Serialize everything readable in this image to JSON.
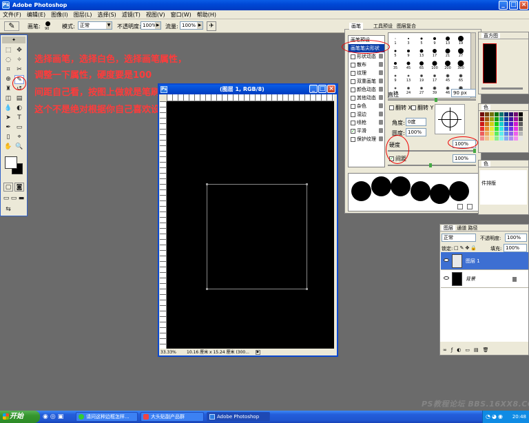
{
  "window": {
    "title": "Adobe Photoshop"
  },
  "menu": [
    "文件(F)",
    "编辑(E)",
    "图像(I)",
    "图层(L)",
    "选择(S)",
    "滤镜(T)",
    "视图(V)",
    "窗口(W)",
    "帮助(H)"
  ],
  "options": {
    "brush_label": "画笔:",
    "brush_size": "90",
    "mode_label": "模式:",
    "mode_value": "正常",
    "opacity_label": "不透明度:",
    "opacity_value": "100%",
    "flow_label": "流量:",
    "flow_value": "100%"
  },
  "annotation": {
    "line1": "选择画笔，选择白色，选择画笔属性，",
    "line2": "调整一下属性，硬度要是100",
    "line3": "间距自己看，按图上做就是笔刷连笔刷",
    "line4": "这个不是绝对根据你自己喜欢设定值"
  },
  "document": {
    "title": "(图层 1, RGB/8)",
    "zoom": "33.33%",
    "status": "10.16 厘米 x 15.24 厘米 (300..."
  },
  "brushes_palette": {
    "tab_brushes": "画笔",
    "tab_presets": "工具预设",
    "tab_comps": "图层复合",
    "list": [
      {
        "label": "画笔预设",
        "checkbox": false,
        "lock": false,
        "checked": false
      },
      {
        "label": "画笔笔尖形状",
        "checkbox": false,
        "lock": false,
        "checked": false
      },
      {
        "label": "形状动态",
        "checkbox": true,
        "lock": true,
        "checked": false
      },
      {
        "label": "散布",
        "checkbox": true,
        "lock": true,
        "checked": false
      },
      {
        "label": "纹理",
        "checkbox": true,
        "lock": true,
        "checked": false
      },
      {
        "label": "双重画笔",
        "checkbox": true,
        "lock": true,
        "checked": false
      },
      {
        "label": "颜色动态",
        "checkbox": true,
        "lock": true,
        "checked": false
      },
      {
        "label": "其他动态",
        "checkbox": true,
        "lock": true,
        "checked": false
      },
      {
        "label": "杂色",
        "checkbox": true,
        "lock": true,
        "checked": false
      },
      {
        "label": "湿边",
        "checkbox": true,
        "lock": true,
        "checked": false
      },
      {
        "label": "喷枪",
        "checkbox": true,
        "lock": true,
        "checked": false
      },
      {
        "label": "平滑",
        "checkbox": true,
        "lock": true,
        "checked": true
      },
      {
        "label": "保护纹理",
        "checkbox": true,
        "lock": true,
        "checked": false
      }
    ],
    "tips": [
      {
        "num": "1",
        "size": 1
      },
      {
        "num": "3",
        "size": 2
      },
      {
        "num": "5",
        "size": 3
      },
      {
        "num": "9",
        "size": 4
      },
      {
        "num": "13",
        "size": 6
      },
      {
        "num": "19",
        "size": 8
      },
      {
        "num": "5",
        "size": 3
      },
      {
        "num": "9",
        "size": 4
      },
      {
        "num": "13",
        "size": 5
      },
      {
        "num": "17",
        "size": 6
      },
      {
        "num": "21",
        "size": 7
      },
      {
        "num": "27",
        "size": 8
      },
      {
        "num": "35",
        "size": 4
      },
      {
        "num": "45",
        "size": 5
      },
      {
        "num": "65",
        "size": 6
      },
      {
        "num": "100",
        "size": 7
      },
      {
        "num": "200",
        "size": 8
      },
      {
        "num": "300",
        "size": 9
      },
      {
        "num": "9",
        "size": 3
      },
      {
        "num": "13",
        "size": 3
      },
      {
        "num": "19",
        "size": 4
      },
      {
        "num": "17",
        "size": 4
      },
      {
        "num": "45",
        "size": 5
      },
      {
        "num": "65",
        "size": 5
      },
      {
        "num": "14",
        "size": 3
      },
      {
        "num": "24",
        "size": 4
      },
      {
        "num": "27",
        "size": 4
      },
      {
        "num": "39",
        "size": 5
      },
      {
        "num": "46",
        "size": 5
      },
      {
        "num": "59",
        "size": 6
      }
    ],
    "diameter_label": "直径",
    "diameter_value": "90 px",
    "flip_x": "翻转 X",
    "flip_y": "翻转 Y",
    "angle_label": "角度:",
    "angle_value": "0度",
    "roundness_label": "圆度:",
    "roundness_value": "100%",
    "hardness_label": "硬度",
    "hardness_value": "100%",
    "spacing_label": "间距",
    "spacing_value": "100%"
  },
  "navigator": {
    "tab": "直方图"
  },
  "swatches": {
    "tab": "色"
  },
  "history": {
    "tab": "色",
    "item": "件排版"
  },
  "layers": {
    "tab_layers": "图层",
    "tab_channels": "通道",
    "tab_paths": "路径",
    "mode": "正常",
    "opacity_label": "不透明度:",
    "opacity_value": "100%",
    "lock_label": "锁定:",
    "fill_label": "填充:",
    "fill_value": "100%",
    "items": [
      {
        "name": "图层 1",
        "selected": true,
        "thumb": "#e8e8e8"
      },
      {
        "name": "背景",
        "selected": false,
        "thumb": "#000000"
      }
    ]
  },
  "taskbar": {
    "start": "开始",
    "tasks": [
      "请问这种边框怎样...",
      "大头贴副产品群",
      "Adobe Photoshop"
    ],
    "time": "20:48"
  },
  "watermark": "PS教程论坛 BBS.16XX8.COM"
}
